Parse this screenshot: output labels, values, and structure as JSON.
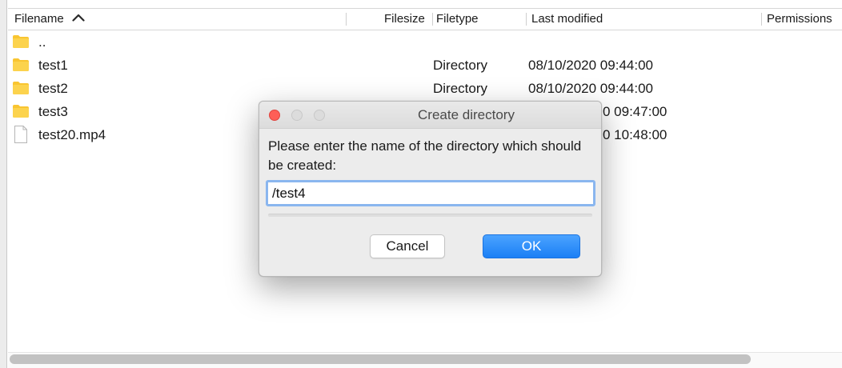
{
  "table": {
    "columns": {
      "filename": "Filename",
      "filesize": "Filesize",
      "filetype": "Filetype",
      "last_modified": "Last modified",
      "permissions": "Permissions"
    },
    "sort": {
      "column": "filename",
      "direction": "ascending",
      "icon": "chevron-up-icon"
    },
    "rows": [
      {
        "name": "..",
        "type": "",
        "modified": "",
        "icon": "folder-icon"
      },
      {
        "name": "test1",
        "type": "Directory",
        "modified": "08/10/2020 09:44:00",
        "icon": "folder-icon"
      },
      {
        "name": "test2",
        "type": "Directory",
        "modified": "08/10/2020 09:44:00",
        "icon": "folder-icon"
      },
      {
        "name": "test3",
        "type": "",
        "modified": "0 09:47:00",
        "icon": "folder-icon"
      },
      {
        "name": "test20.mp4",
        "type": "",
        "modified": "0 10:48:00",
        "icon": "file-icon"
      }
    ]
  },
  "dialog": {
    "title": "Create directory",
    "message": "Please enter the name of the directory which should be created:",
    "input_value": "/test4",
    "cancel_label": "Cancel",
    "ok_label": "OK"
  },
  "colors": {
    "folder": "#f9c531",
    "ok_button": "#1b7ff5",
    "close_button": "#fe5f57",
    "focus_ring": "#8ab6ef"
  }
}
